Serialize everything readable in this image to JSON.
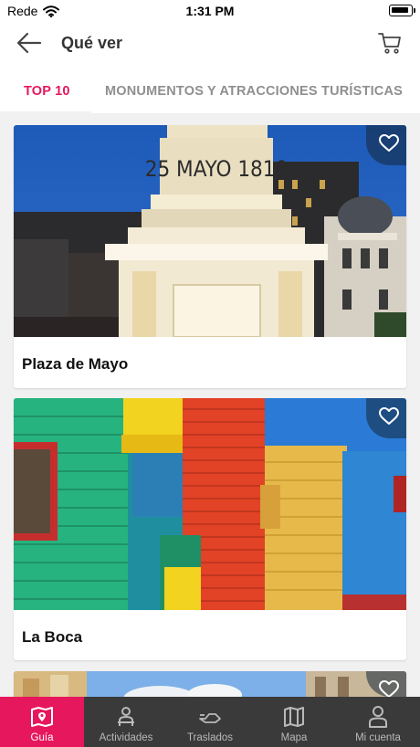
{
  "status_bar": {
    "carrier": "Rede",
    "time": "1:31 PM"
  },
  "header": {
    "title": "Qué ver",
    "back_icon": "arrow-left-icon",
    "cart_icon": "cart-icon"
  },
  "tabs": [
    {
      "label": "TOP 10",
      "active": true
    },
    {
      "label": "MONUMENTOS Y ATRACCIONES TURÍSTICAS",
      "active": false
    }
  ],
  "cards": [
    {
      "title": "Plaza de Mayo",
      "image_text": "25 MAYO 1810",
      "favorite_icon": "heart-icon"
    },
    {
      "title": "La Boca",
      "favorite_icon": "heart-icon"
    },
    {
      "title": "",
      "favorite_icon": "heart-icon"
    }
  ],
  "bottom_nav": [
    {
      "label": "Guía",
      "icon": "map-book-icon",
      "active": true
    },
    {
      "label": "Actividades",
      "icon": "person-activity-icon",
      "active": false
    },
    {
      "label": "Traslados",
      "icon": "transfer-icon",
      "active": false
    },
    {
      "label": "Mapa",
      "icon": "map-icon",
      "active": false
    },
    {
      "label": "Mi cuenta",
      "icon": "user-icon",
      "active": false
    }
  ],
  "colors": {
    "accent": "#e6175c",
    "nav_background": "#3a3a3a"
  }
}
